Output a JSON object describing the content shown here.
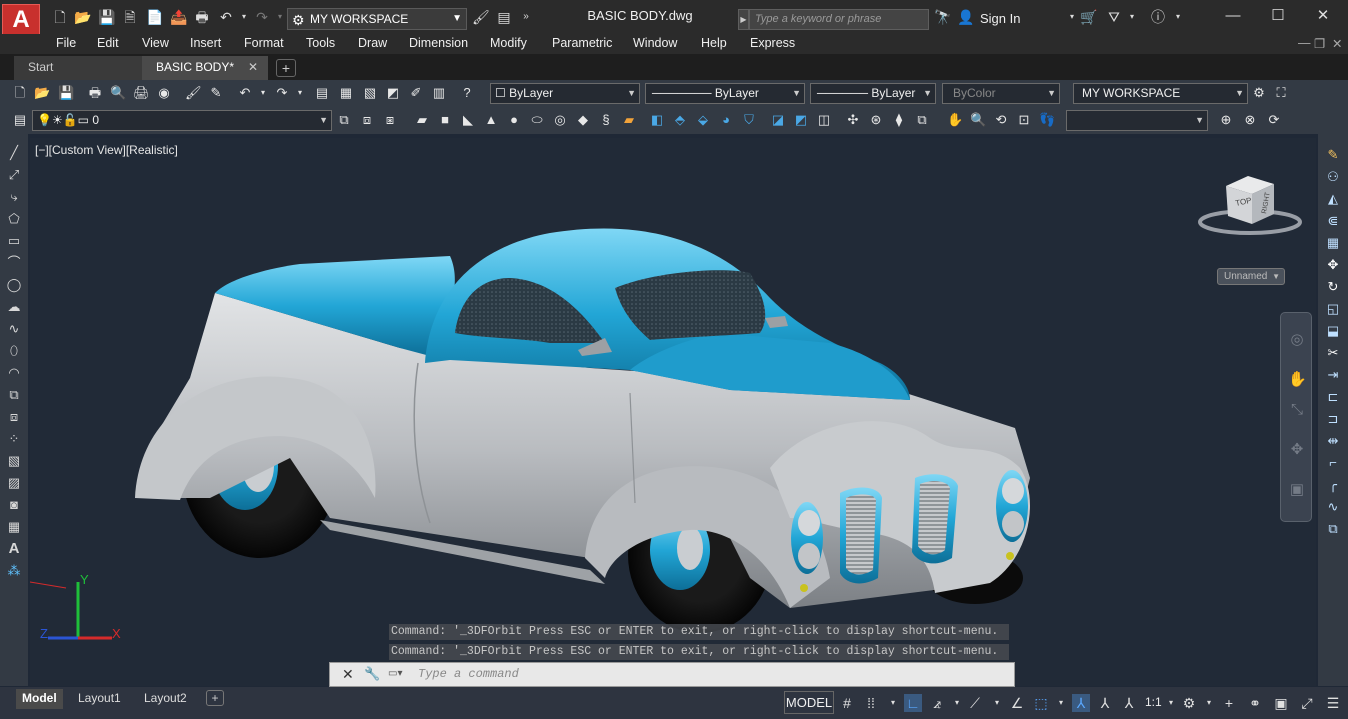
{
  "title_bar": {
    "app_logo": "A",
    "workspace": "MY WORKSPACE",
    "document_title": "BASIC BODY.dwg",
    "search_placeholder": "Type a keyword or phrase",
    "sign_in": "Sign In"
  },
  "menu": [
    "File",
    "Edit",
    "View",
    "Insert",
    "Format",
    "Tools",
    "Draw",
    "Dimension",
    "Modify",
    "Parametric",
    "Window",
    "Help",
    "Express"
  ],
  "file_tabs": [
    {
      "label": "Start"
    },
    {
      "label": "BASIC BODY*"
    }
  ],
  "properties_toolbar": {
    "color": "ByLayer",
    "linetype": "ByLayer",
    "lineweight": "ByLayer",
    "plot_style": "ByColor",
    "workspace": "MY WORKSPACE"
  },
  "layers_toolbar": {
    "current_layer": "0"
  },
  "viewport": {
    "label": "[−][Custom View][Realistic]",
    "viewcube_top": "TOP",
    "viewcube_right": "RIGHT",
    "ucs_name": "Unnamed",
    "axis_x": "X",
    "axis_y": "Y",
    "axis_z": "Z"
  },
  "command": {
    "history": [
      "Command: '_3DFOrbit Press ESC or ENTER to exit, or right-click to display shortcut-menu.",
      "Command: '_3DFOrbit Press ESC or ENTER to exit, or right-click to display shortcut-menu."
    ],
    "placeholder": "Type a command"
  },
  "layout_tabs": [
    "Model",
    "Layout1",
    "Layout2"
  ],
  "status_bar": {
    "model": "MODEL",
    "annotation_scale": "1:1"
  },
  "colors": {
    "car_body": "#bcbec0",
    "car_accent": "#23a7d6",
    "viewport_bg": "#212a37",
    "autocad_red": "#c8302d"
  }
}
